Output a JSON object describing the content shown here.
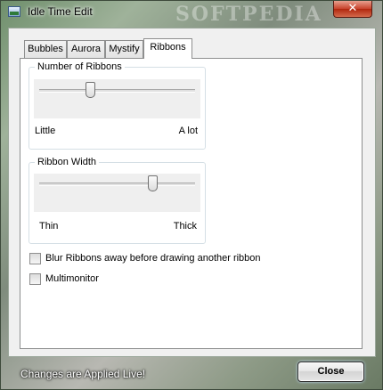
{
  "window": {
    "title": "Idle Time Edit",
    "watermark": "SOFTPEDIA",
    "close_glyph": "✕",
    "close_icon": "close-icon"
  },
  "tabs": [
    "Bubbles",
    "Aurora",
    "Mystify",
    "Ribbons"
  ],
  "active_tab": "Ribbons",
  "ribbons": {
    "number_of_ribbons": {
      "label": "Number of Ribbons",
      "min_label": "Little",
      "max_label": "A lot",
      "level": 0.33
    },
    "ribbon_width": {
      "label": "Ribbon Width",
      "min_label": "Thin",
      "max_label": "Thick",
      "level": 0.73
    },
    "blur_checkbox": {
      "label": "Blur Ribbons away before drawing another ribbon",
      "checked": false
    },
    "multimonitor_checkbox": {
      "label": "Multimonitor",
      "checked": false
    }
  },
  "footer": {
    "status": "Changes are Applied Live!",
    "close_label": "Close"
  },
  "colors": {
    "close_button_red": "#c7412a",
    "panel_background": "#f0f0f0",
    "status_text": "#ffffff"
  }
}
